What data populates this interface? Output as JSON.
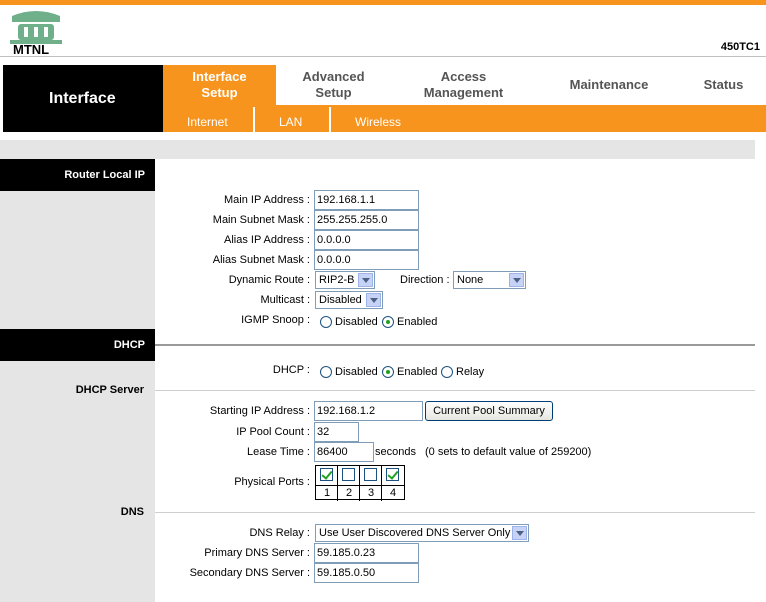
{
  "brand": {
    "logo_text": "MTNL",
    "model": "450TC1",
    "accent": "#f7941d"
  },
  "nav": {
    "section": "Interface",
    "tabs": [
      {
        "label": "Interface Setup",
        "active": true
      },
      {
        "label": "Advanced Setup"
      },
      {
        "label": "Access Management"
      },
      {
        "label": "Maintenance"
      },
      {
        "label": "Status"
      }
    ],
    "subtabs": [
      "Internet",
      "LAN",
      "Wireless"
    ]
  },
  "router_local_ip": {
    "title": "Router Local IP",
    "main_ip_label": "Main IP Address :",
    "main_ip": "192.168.1.1",
    "main_mask_label": "Main Subnet Mask :",
    "main_mask": "255.255.255.0",
    "alias_ip_label": "Alias IP Address :",
    "alias_ip": "0.0.0.0",
    "alias_mask_label": "Alias Subnet Mask :",
    "alias_mask": "0.0.0.0",
    "dynamic_route_label": "Dynamic Route :",
    "dynamic_route": "RIP2-B",
    "direction_label": "Direction :",
    "direction": "None",
    "multicast_label": "Multicast :",
    "multicast": "Disabled",
    "igmp_label": "IGMP Snoop :",
    "igmp_disabled": "Disabled",
    "igmp_enabled": "Enabled",
    "igmp_value": "Enabled"
  },
  "dhcp": {
    "title": "DHCP",
    "dhcp_label": "DHCP :",
    "opt_disabled": "Disabled",
    "opt_enabled": "Enabled",
    "opt_relay": "Relay",
    "value": "Enabled",
    "server_title": "DHCP Server",
    "start_ip_label": "Starting IP Address :",
    "start_ip": "192.168.1.2",
    "pool_button": "Current Pool Summary",
    "pool_count_label": "IP Pool Count :",
    "pool_count": "32",
    "lease_label": "Lease Time :",
    "lease": "86400",
    "lease_unit": "seconds",
    "lease_note": "(0 sets to default value of 259200)",
    "ports_label": "Physical Ports :",
    "ports": [
      {
        "num": "1",
        "checked": true
      },
      {
        "num": "2",
        "checked": false
      },
      {
        "num": "3",
        "checked": false
      },
      {
        "num": "4",
        "checked": true
      }
    ]
  },
  "dns": {
    "title": "DNS",
    "relay_label": "DNS Relay :",
    "relay": "Use User Discovered DNS Server Only",
    "primary_label": "Primary DNS Server :",
    "primary": "59.185.0.23",
    "secondary_label": "Secondary DNS Server :",
    "secondary": "59.185.0.50"
  }
}
